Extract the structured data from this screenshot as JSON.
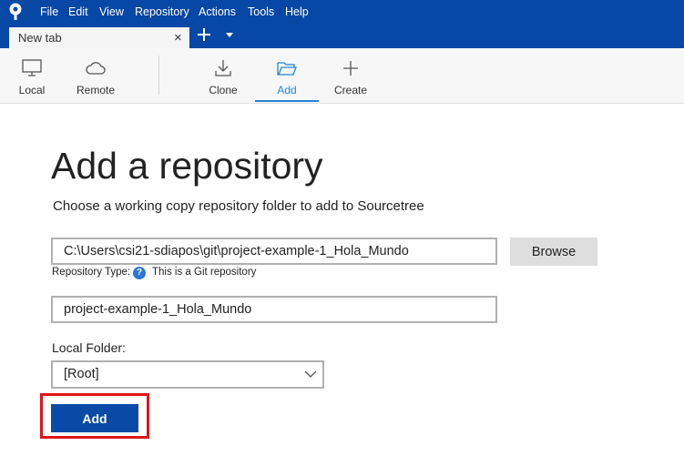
{
  "menubar": {
    "items": [
      "File",
      "Edit",
      "View",
      "Repository",
      "Actions",
      "Tools",
      "Help"
    ]
  },
  "tabs": [
    {
      "label": "New tab",
      "close_glyph": "×"
    }
  ],
  "toolbar": {
    "items": [
      {
        "label": "Local",
        "icon": "monitor-icon"
      },
      {
        "label": "Remote",
        "icon": "cloud-icon"
      },
      {
        "label": "Clone",
        "icon": "download-icon"
      },
      {
        "label": "Add",
        "icon": "folder-open-icon",
        "active": true
      },
      {
        "label": "Create",
        "icon": "plus-icon"
      }
    ]
  },
  "main": {
    "title": "Add a repository",
    "subtitle": "Choose a working copy repository folder to add to Sourcetree",
    "path_value": "C:\\Users\\csi21-sdiapos\\git\\project-example-1_Hola_Mundo",
    "browse_label": "Browse",
    "repo_type_label": "Repository Type:",
    "help_glyph": "?",
    "repo_type_value": "This is a Git repository",
    "name_value": "project-example-1_Hola_Mundo",
    "local_folder_label": "Local Folder:",
    "local_folder_value": "[Root]",
    "add_label": "Add"
  },
  "colors": {
    "menubar_bg": "#0747a6",
    "accent": "#1f86d8",
    "primary_button": "#0a4aa6",
    "highlight_border": "#e0141b"
  }
}
